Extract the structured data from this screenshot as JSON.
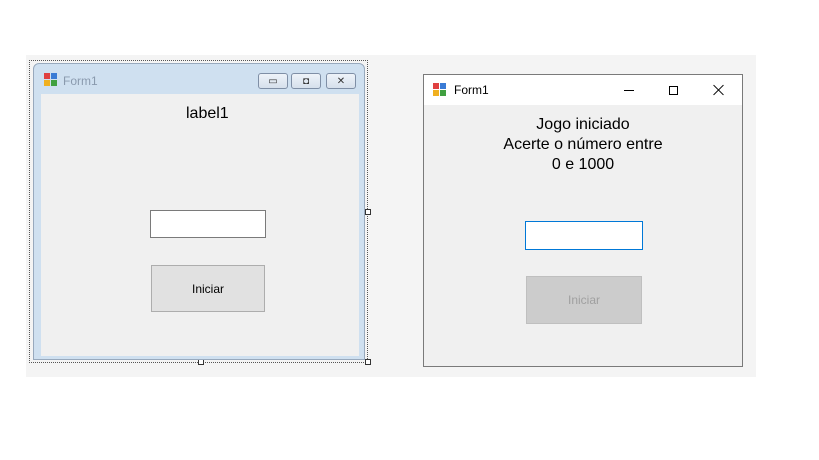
{
  "designer_form": {
    "title": "Form1",
    "label_text": "label1",
    "textbox_value": "",
    "button_label": "Iniciar",
    "window_buttons": [
      "minimize-icon",
      "restore-icon",
      "close-icon"
    ]
  },
  "running_form": {
    "title": "Form1",
    "message_lines": [
      "Jogo iniciado",
      "Acerte o número entre",
      "0 e 1000"
    ],
    "textbox_value": "",
    "button_label": "Iniciar",
    "button_enabled": false,
    "window_buttons": [
      "minimize-icon",
      "maximize-icon",
      "close-icon"
    ]
  },
  "colors": {
    "designer_frame": "#cfe0f0",
    "client_bg": "#f0f0f0",
    "textbox_focus_border": "#0078d7",
    "disabled_button_bg": "#cccccc"
  }
}
